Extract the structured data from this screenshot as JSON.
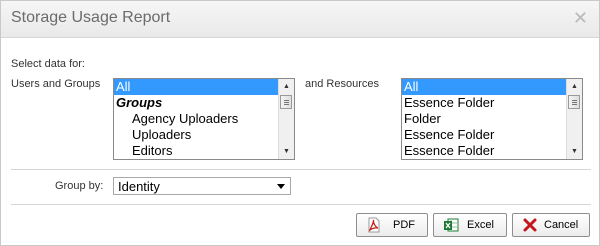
{
  "dialog": {
    "title": "Storage Usage Report",
    "close_glyph": "✕"
  },
  "form": {
    "select_data_label": "Select data for:",
    "users_groups_label": "Users and Groups",
    "resources_label": "and Resources",
    "group_by_label": "Group by:",
    "group_by_value": "Identity"
  },
  "users_list": {
    "items": [
      {
        "label": "All",
        "selected": true
      },
      {
        "label": "Groups",
        "type": "group-header"
      },
      {
        "label": "Agency Uploaders"
      },
      {
        "label": "Uploaders"
      },
      {
        "label": "Editors"
      }
    ]
  },
  "resources_list": {
    "items": [
      {
        "label": "All",
        "selected": true
      },
      {
        "label": "Essence Folder"
      },
      {
        "label": "Folder"
      },
      {
        "label": "Essence Folder"
      },
      {
        "label": "Essence Folder"
      }
    ]
  },
  "buttons": {
    "pdf_label": "PDF",
    "excel_label": "Excel",
    "cancel_label": "Cancel"
  },
  "icons": {
    "pdf": "pdf-file-icon",
    "excel": "excel-file-icon",
    "cancel": "red-x-icon",
    "close": "close-icon"
  },
  "colors": {
    "selection": "#3399ff",
    "pdf_red": "#cc1b1b",
    "excel_green": "#1e7b34",
    "cancel_red": "#c4161c"
  }
}
